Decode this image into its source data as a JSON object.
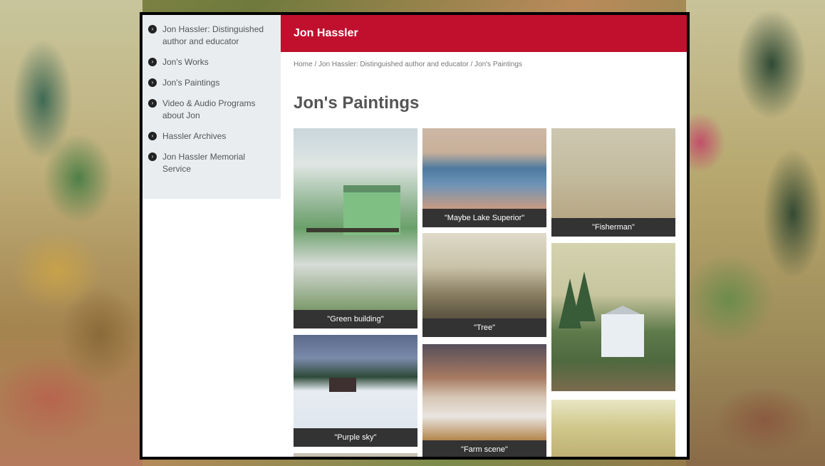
{
  "sidebar": {
    "items": [
      {
        "label": "Jon Hassler: Distinguished author and educator"
      },
      {
        "label": "Jon's Works"
      },
      {
        "label": "Jon's Paintings"
      },
      {
        "label": "Video & Audio Programs about Jon"
      },
      {
        "label": "Hassler Archives"
      },
      {
        "label": "Jon Hassler Memorial Service"
      }
    ]
  },
  "header": {
    "title": "Jon Hassler"
  },
  "breadcrumb": {
    "text": "Home / Jon Hassler: Distinguished author and educator / Jon's Paintings"
  },
  "page": {
    "title": "Jon's Paintings"
  },
  "gallery": {
    "items": [
      {
        "caption": "\"Green building\""
      },
      {
        "caption": "\"Maybe Lake Superior\""
      },
      {
        "caption": "\"Fisherman\""
      },
      {
        "caption": "\"Tree\""
      },
      {
        "caption": "\"Purple sky\""
      },
      {
        "caption": "\"Farm scene\""
      }
    ]
  },
  "colors": {
    "accent": "#c0102e",
    "sidebar_bg": "#e9edf0"
  }
}
